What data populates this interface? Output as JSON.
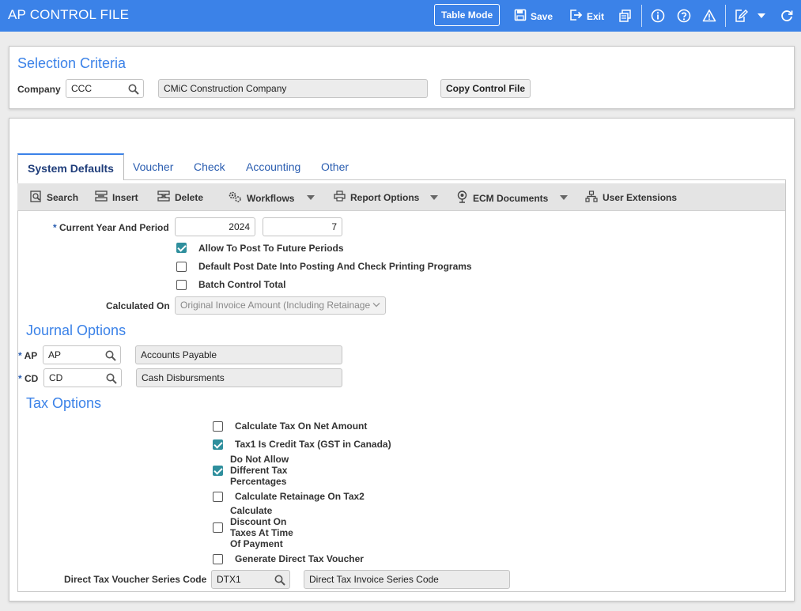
{
  "header": {
    "title": "AP CONTROL FILE",
    "table_mode": "Table Mode",
    "save": "Save",
    "exit": "Exit"
  },
  "selection": {
    "title": "Selection Criteria",
    "company_label": "Company",
    "company_code": "CCC",
    "company_name": "CMiC Construction Company",
    "copy_button": "Copy Control File"
  },
  "tabs": [
    {
      "label": "System Defaults",
      "active": true
    },
    {
      "label": "Voucher"
    },
    {
      "label": "Check"
    },
    {
      "label": "Accounting"
    },
    {
      "label": "Other"
    }
  ],
  "toolbar": {
    "search": "Search",
    "insert": "Insert",
    "delete": "Delete",
    "workflows": "Workflows",
    "report_options": "Report Options",
    "ecm_documents": "ECM Documents",
    "user_extensions": "User Extensions"
  },
  "defaults": {
    "year_period_label": "Current Year And Period",
    "year": "2024",
    "period": "7",
    "allow_future": {
      "label": "Allow To Post To Future Periods",
      "checked": true
    },
    "default_post_date": {
      "label": "Default Post Date Into Posting And Check Printing Programs",
      "checked": false
    },
    "batch_control": {
      "label": "Batch Control Total",
      "checked": false
    },
    "calculated_on_label": "Calculated On",
    "calculated_on_value": "Original Invoice Amount (Including Retainage"
  },
  "journal": {
    "title": "Journal Options",
    "ap_label": "AP",
    "ap_code": "AP",
    "ap_name": "Accounts Payable",
    "cd_label": "CD",
    "cd_code": "CD",
    "cd_name": "Cash Disbursments"
  },
  "tax": {
    "title": "Tax Options",
    "net_amount": {
      "label": "Calculate Tax On Net Amount",
      "checked": false
    },
    "tax1_credit": {
      "label": "Tax1 Is Credit Tax (GST in Canada)",
      "checked": true
    },
    "no_diff": {
      "label_lines": [
        "Do Not Allow",
        "Different Tax",
        "Percentages"
      ],
      "checked": true
    },
    "retainage_tax2": {
      "label": "Calculate Retainage On Tax2",
      "checked": false
    },
    "discount": {
      "label_lines": [
        "Calculate",
        "Discount On",
        "Taxes At Time",
        "Of Payment"
      ],
      "checked": false
    },
    "direct_voucher": {
      "label": "Generate Direct Tax Voucher",
      "checked": false
    },
    "series_label": "Direct Tax Voucher Series Code",
    "series_code": "DTX1",
    "series_name": "Direct Tax Invoice Series Code"
  },
  "colors": {
    "accent": "#3b82e8",
    "check": "#2f8f9d"
  }
}
